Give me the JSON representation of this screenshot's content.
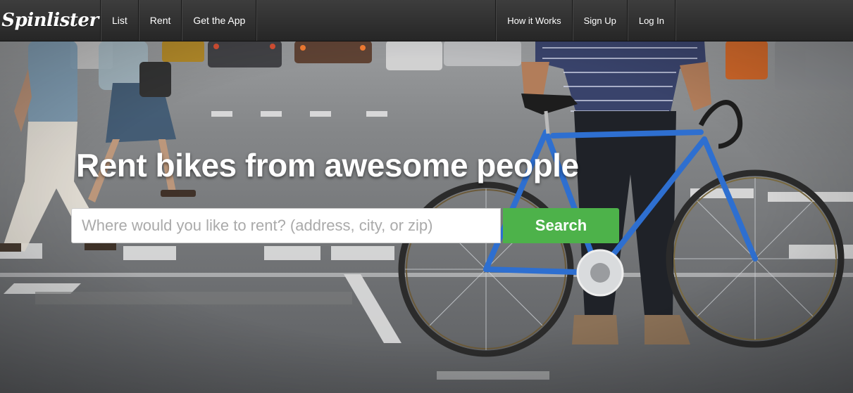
{
  "brand": {
    "logo_text": "Spinlister"
  },
  "nav": {
    "left": [
      {
        "label": "List"
      },
      {
        "label": "Rent"
      },
      {
        "label": "Get the App"
      }
    ],
    "right": [
      {
        "label": "How it Works"
      },
      {
        "label": "Sign Up"
      },
      {
        "label": "Log In"
      }
    ]
  },
  "hero": {
    "headline": "Rent bikes from awesome people",
    "search": {
      "placeholder": "Where would you like to rent? (address, city, or zip)",
      "value": "",
      "button_label": "Search"
    }
  },
  "colors": {
    "nav_bg": "#2f2f2f",
    "search_button": "#4db24a",
    "bike_frame": "#2e6fd0"
  }
}
